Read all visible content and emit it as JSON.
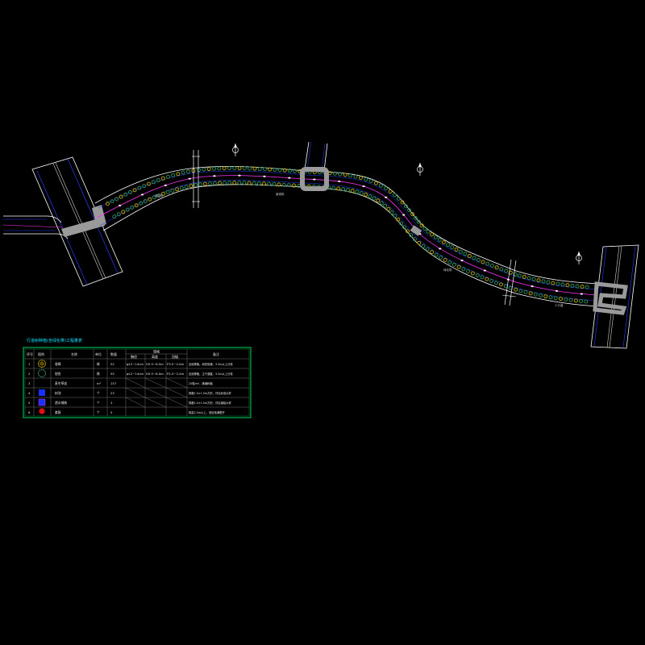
{
  "drawing": {
    "title": "",
    "north_symbols": [
      "north-arrow-1",
      "north-arrow-2",
      "north-arrow-3"
    ]
  },
  "road_labels": [
    "绿化带",
    "景观带",
    "绿化带",
    "人行道"
  ],
  "legend_table": {
    "title": "行道树种植(含绿化带)工程量表",
    "header": [
      "序号",
      "图例",
      "名称",
      "单位",
      "数量",
      "规格",
      "",
      "",
      "备注"
    ],
    "spec_subheader": [
      "胸径",
      "高度",
      "冠幅"
    ],
    "rows": [
      {
        "no": "1",
        "icon": "tree-canopy-icon",
        "name": "香樟",
        "unit": "株",
        "qty": "52",
        "dbh": "φ12~14cm",
        "height": "H5.5~6.0m",
        "crown": "P3.5~4.0m",
        "note": "全冠移植，树形饱满，3.5m以上分枝"
      },
      {
        "no": "2",
        "icon": "shrub-ring-icon",
        "name": "银杏",
        "unit": "株",
        "qty": "55",
        "dbh": "φ12~14cm",
        "height": "H5.5~6.0m",
        "crown": "P2.5~3.2m",
        "note": "全冠移植，主干通直，3.2m以上分枝"
      },
      {
        "no": "3",
        "icon": "",
        "name": "麦冬草皮",
        "unit": "m²",
        "qty": "157",
        "dbh": "",
        "height": "",
        "crown": "",
        "note": "25株/m²，满铺种植"
      },
      {
        "no": "4",
        "icon": "blue-square-icon",
        "name": "树池",
        "unit": "个",
        "qty": "23",
        "dbh": "",
        "height": "",
        "crown": "",
        "note": "规格1.5×1.5m方形，详见树池大样"
      },
      {
        "no": "5",
        "icon": "blue-square-small-icon",
        "name": "透水铺装",
        "unit": "个",
        "qty": "3",
        "dbh": "",
        "height": "",
        "crown": "",
        "note": "规格1.5×1.5m方形，详见铺装大样"
      },
      {
        "no": "6",
        "icon": "red-flower-icon",
        "name": "紫薇",
        "unit": "个",
        "qty": "5",
        "dbh": "",
        "height": "",
        "crown": "",
        "note": "株高2.5m以上，冠径饱满整齐"
      }
    ]
  },
  "colors": {
    "background": "#000000",
    "road_edge": "#ffffff",
    "center_line": "#ff33ff",
    "curb_line": "#2a3cff",
    "tree_green": "#2e8b57",
    "tree_yellow": "#b0a000",
    "table_frame": "#00b050",
    "table_grid": "#8a8a8a",
    "accent_cyan": "#00e5ff"
  }
}
